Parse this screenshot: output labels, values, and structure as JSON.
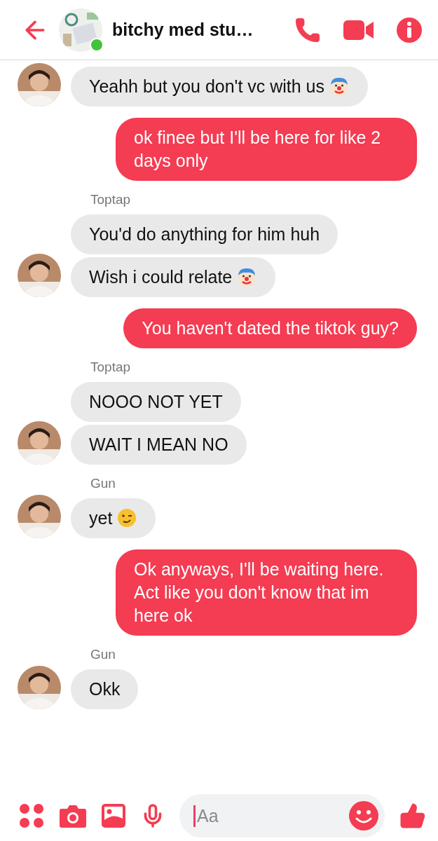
{
  "header": {
    "title": "bitchy med stu…",
    "online": true
  },
  "thread": [
    {
      "kind": "incoming",
      "messages": [
        {
          "text": "Yeahh but you don't vc with us",
          "kind": "clown-emoji"
        }
      ]
    },
    {
      "kind": "outgoing",
      "messages": [
        {
          "text": "ok finee but I'll be here for like 2 days only",
          "kind": "plain"
        }
      ]
    },
    {
      "kind": "incoming",
      "sender": "Toptap",
      "messages": [
        {
          "text": "You'd do anything for him huh",
          "kind": "plain"
        },
        {
          "text": "Wish i could relate",
          "kind": "clown-emoji"
        }
      ]
    },
    {
      "kind": "outgoing",
      "messages": [
        {
          "text": "You haven't dated the tiktok guy?",
          "kind": "plain"
        }
      ]
    },
    {
      "kind": "incoming",
      "sender": "Toptap",
      "messages": [
        {
          "text": "NOOO NOT YET",
          "kind": "plain"
        },
        {
          "text": "WAIT I MEAN NO",
          "kind": "plain"
        }
      ]
    },
    {
      "kind": "incoming",
      "sender": "Gun",
      "messages": [
        {
          "text": "yet",
          "kind": "wink-emoji"
        }
      ]
    },
    {
      "kind": "outgoing",
      "messages": [
        {
          "text": "Ok anyways, I'll be waiting here. Act like you don't know that im here ok",
          "kind": "plain"
        }
      ]
    },
    {
      "kind": "incoming",
      "sender": "Gun",
      "messages": [
        {
          "text": "Okk",
          "kind": "plain"
        }
      ]
    }
  ],
  "composer": {
    "placeholder": "Aa"
  }
}
